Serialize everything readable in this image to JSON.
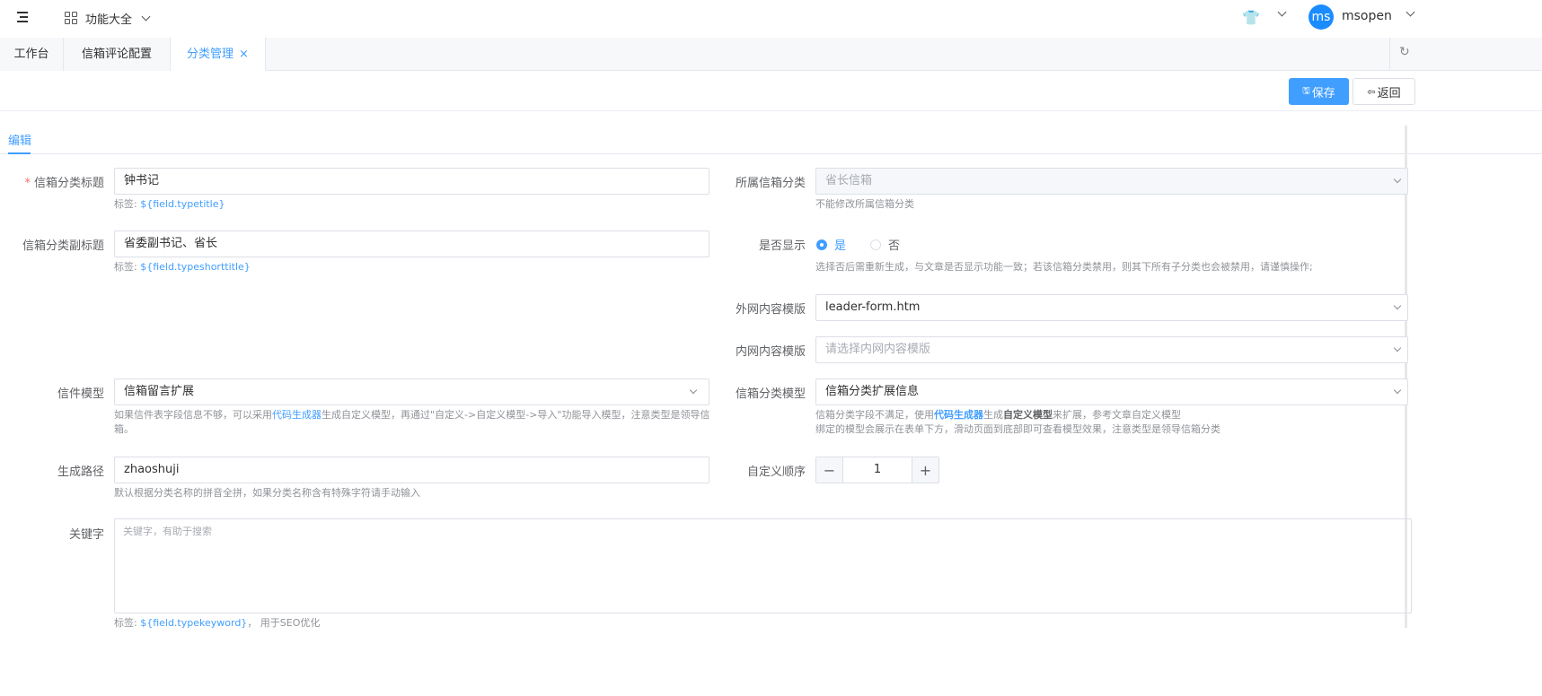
{
  "header": {
    "apps_label": "功能大全",
    "avatar_text": "ms",
    "username": "msopen"
  },
  "tabs": [
    {
      "label": "工作台"
    },
    {
      "label": "信箱评论配置"
    },
    {
      "label": "分类管理",
      "close": "×"
    }
  ],
  "toolbar": {
    "save_label": "保存",
    "back_label": "返回"
  },
  "subtab": "编辑",
  "form": {
    "title": {
      "label": "信箱分类标题",
      "required": "*",
      "value": "钟书记",
      "help_prefix": "标签: ",
      "help_code": "${field.typetitle}"
    },
    "subtitle": {
      "label": "信箱分类副标题",
      "value": "省委副书记、省长",
      "help_prefix": "标签: ",
      "help_code": "${field.typeshorttitle}"
    },
    "mailbox_category": {
      "label": "所属信箱分类",
      "value": "省长信箱",
      "help": "不能修改所属信箱分类"
    },
    "display": {
      "label": "是否显示",
      "yes": "是",
      "no": "否",
      "selected": "是",
      "help": "选择否后需重新生成，与文章是否显示功能一致；若该信箱分类禁用，则其下所有子分类也会被禁用，请谨慎操作;"
    },
    "external_template": {
      "label": "外网内容模版",
      "value": "leader-form.htm"
    },
    "internal_template": {
      "label": "内网内容模版",
      "placeholder": "请选择内网内容模版"
    },
    "letter_model": {
      "label": "信件模型",
      "value": "信箱留言扩展",
      "help_1": "如果信件表字段信息不够，可以采用",
      "help_link": "代码生成器",
      "help_2": "生成自定义模型，再通过\"自定义->自定义模型->导入\"功能导入模型，注意类型是领导信",
      "help_3": "箱。"
    },
    "category_model": {
      "label": "信箱分类模型",
      "value": "信箱分类扩展信息",
      "help_1": "信箱分类字段不满足，使用",
      "help_link": "代码生成器",
      "help_2": "生成",
      "help_bold": "自定义模型",
      "help_3": "来扩展，参考文章自定义模型",
      "help_line2": "绑定的模型会展示在表单下方，滑动页面到底部即可查看模型效果，注意类型是领导信箱分类"
    },
    "path": {
      "label": "生成路径",
      "value": "zhaoshuji",
      "help": "默认根据分类名称的拼音全拼，如果分类名称含有特殊字符请手动输入"
    },
    "order": {
      "label": "自定义顺序",
      "value": "1",
      "minus": "−",
      "plus": "+"
    },
    "keywords": {
      "label": "关键字",
      "placeholder": "关键字，有助于搜索",
      "help_prefix": "标签: ",
      "help_code": "${field.typekeyword}",
      "help_suffix": "， 用于SEO优化"
    }
  }
}
